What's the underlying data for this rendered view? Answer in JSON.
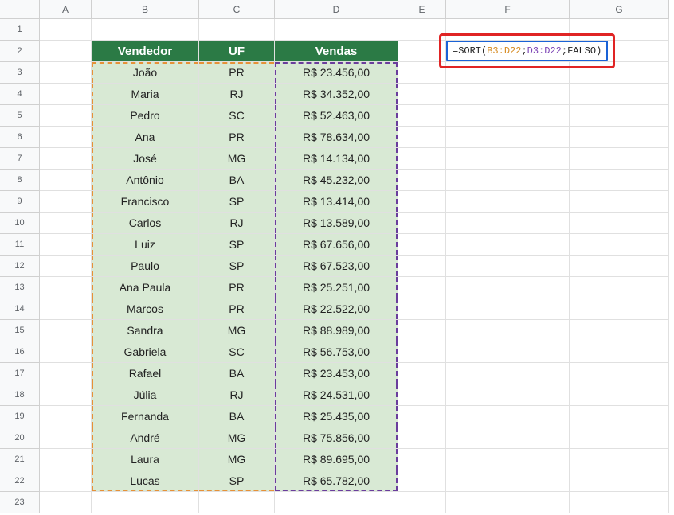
{
  "columns": [
    "A",
    "B",
    "C",
    "D",
    "E",
    "F",
    "G"
  ],
  "row_count": 23,
  "headers": {
    "vendedor": "Vendedor",
    "uf": "UF",
    "vendas": "Vendas"
  },
  "rows": [
    {
      "vendedor": "João",
      "uf": "PR",
      "vendas": "R$ 23.456,00"
    },
    {
      "vendedor": "Maria",
      "uf": "RJ",
      "vendas": "R$ 34.352,00"
    },
    {
      "vendedor": "Pedro",
      "uf": "SC",
      "vendas": "R$ 52.463,00"
    },
    {
      "vendedor": "Ana",
      "uf": "PR",
      "vendas": "R$ 78.634,00"
    },
    {
      "vendedor": "José",
      "uf": "MG",
      "vendas": "R$ 14.134,00"
    },
    {
      "vendedor": "Antônio",
      "uf": "BA",
      "vendas": "R$ 45.232,00"
    },
    {
      "vendedor": "Francisco",
      "uf": "SP",
      "vendas": "R$ 13.414,00"
    },
    {
      "vendedor": "Carlos",
      "uf": "RJ",
      "vendas": "R$ 13.589,00"
    },
    {
      "vendedor": "Luiz",
      "uf": "SP",
      "vendas": "R$ 67.656,00"
    },
    {
      "vendedor": "Paulo",
      "uf": "SP",
      "vendas": "R$ 67.523,00"
    },
    {
      "vendedor": "Ana Paula",
      "uf": "PR",
      "vendas": "R$ 25.251,00"
    },
    {
      "vendedor": "Marcos",
      "uf": "PR",
      "vendas": "R$ 22.522,00"
    },
    {
      "vendedor": "Sandra",
      "uf": "MG",
      "vendas": "R$ 88.989,00"
    },
    {
      "vendedor": "Gabriela",
      "uf": "SC",
      "vendas": "R$ 56.753,00"
    },
    {
      "vendedor": "Rafael",
      "uf": "BA",
      "vendas": "R$ 23.453,00"
    },
    {
      "vendedor": "Júlia",
      "uf": "RJ",
      "vendas": "R$ 24.531,00"
    },
    {
      "vendedor": "Fernanda",
      "uf": "BA",
      "vendas": "R$ 25.435,00"
    },
    {
      "vendedor": "André",
      "uf": "MG",
      "vendas": "R$ 75.856,00"
    },
    {
      "vendedor": "Laura",
      "uf": "MG",
      "vendas": "R$ 89.695,00"
    },
    {
      "vendedor": "Lucas",
      "uf": "SP",
      "vendas": "R$ 65.782,00"
    }
  ],
  "formula": {
    "prefix": "=SORT(",
    "range1": "B3:D22",
    "sep1": ";",
    "range2": "D3:D22",
    "sep2": ";",
    "keyword": "FALSO",
    "suffix": ")"
  },
  "colors": {
    "header_bg": "#2b7a45",
    "data_bg": "#d8e9d4",
    "sel1": "#e69138",
    "sel2": "#6a3d9c",
    "callout": "#e02424",
    "active": "#1a62d6"
  }
}
